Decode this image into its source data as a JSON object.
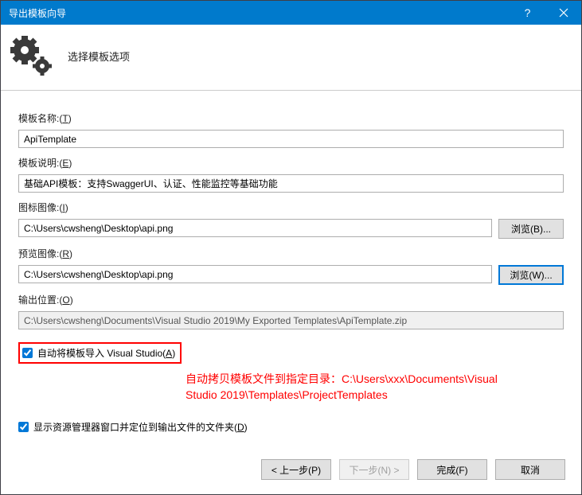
{
  "titlebar": {
    "title": "导出模板向导"
  },
  "header": {
    "title": "选择模板选项"
  },
  "fields": {
    "name_label_pre": "模板名称:(",
    "name_label_ul": "T",
    "name_label_post": ")",
    "name_value": "ApiTemplate",
    "desc_label_pre": "模板说明:(",
    "desc_label_ul": "E",
    "desc_label_post": ")",
    "desc_value": "基础API模板：支持SwaggerUI、认证、性能监控等基础功能",
    "icon_label_pre": "图标图像:(",
    "icon_label_ul": "I",
    "icon_label_post": ")",
    "icon_value": "C:\\Users\\cwsheng\\Desktop\\api.png",
    "icon_browse_pre": "浏览(",
    "icon_browse_ul": "B",
    "icon_browse_post": ")...",
    "preview_label_pre": "预览图像:(",
    "preview_label_ul": "R",
    "preview_label_post": ")",
    "preview_value": "C:\\Users\\cwsheng\\Desktop\\api.png",
    "preview_browse_pre": "浏览(",
    "preview_browse_ul": "W",
    "preview_browse_post": ")...",
    "output_label_pre": "输出位置:(",
    "output_label_ul": "O",
    "output_label_post": ")",
    "output_value": "C:\\Users\\cwsheng\\Documents\\Visual Studio 2019\\My Exported Templates\\ApiTemplate.zip"
  },
  "checkboxes": {
    "auto_import_pre": "自动将模板导入 Visual Studio(",
    "auto_import_ul": "A",
    "auto_import_post": ")",
    "auto_import_checked": true,
    "show_explorer_pre": "显示资源管理器窗口并定位到输出文件的文件夹(",
    "show_explorer_ul": "D",
    "show_explorer_post": ")",
    "show_explorer_checked": true
  },
  "annotation": {
    "line1": "自动拷贝模板文件到指定目录：C:\\Users\\xxx\\Documents\\Visual",
    "line2": "Studio 2019\\Templates\\ProjectTemplates"
  },
  "footer": {
    "prev_pre": "< 上一步(",
    "prev_ul": "P",
    "prev_post": ")",
    "next_pre": "下一步(",
    "next_ul": "N",
    "next_post": ") >",
    "finish_pre": "完成(",
    "finish_ul": "F",
    "finish_post": ")",
    "cancel": "取消"
  }
}
